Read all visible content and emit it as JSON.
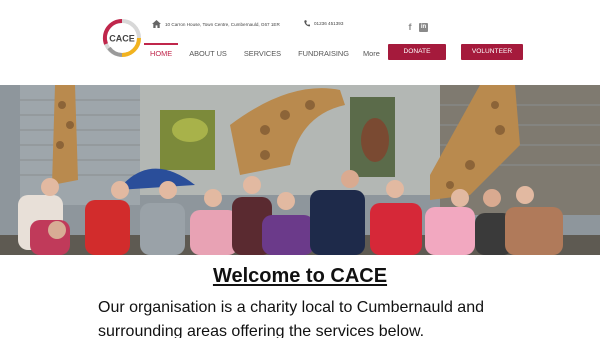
{
  "header": {
    "logo_text": "CACE",
    "address": "10 Carron House, Town Centre, Cumbernauld, G67 1ER",
    "phone": "01236 451393",
    "social_icons": [
      "facebook-icon",
      "linkedin-icon"
    ]
  },
  "nav": {
    "items": [
      "HOME",
      "ABOUT US",
      "SERVICES",
      "FUNDRAISING",
      "More"
    ],
    "active": "HOME"
  },
  "buttons": {
    "donate": "DONATE",
    "volunteer": "VOLUNTEER"
  },
  "colors": {
    "accent": "#a51a3c",
    "nav_active": "#c0264b",
    "logo_red": "#c0264b",
    "logo_yellow": "#f2b31f",
    "logo_gray": "#9a9a9a"
  },
  "hero": {
    "description_icon": "group-photo"
  },
  "content": {
    "welcome_title": "Welcome to CACE",
    "intro_text": "Our organisation is a charity local to Cumbernauld and surrounding areas offering the services below."
  }
}
